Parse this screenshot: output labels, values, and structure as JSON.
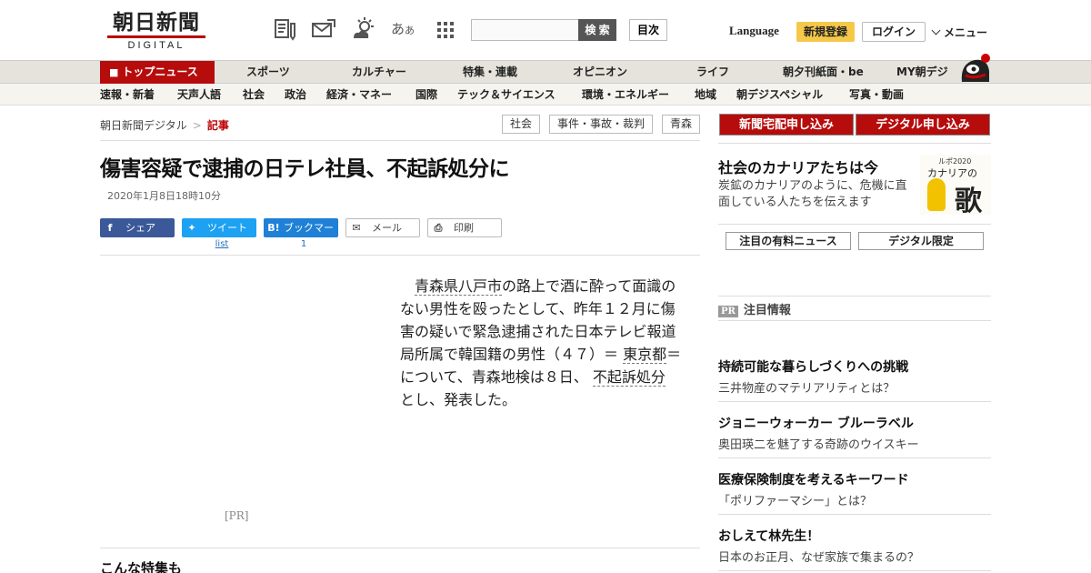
{
  "header": {
    "logo_kanji": "朝日新聞",
    "logo_sub": "DIGITAL",
    "search_button": "検 索",
    "search_placeholder": "",
    "toc_button": "目次",
    "language": "Language",
    "register": "新規登録",
    "login": "ログイン",
    "menu": "メニュー"
  },
  "nav": {
    "top": "トップニュース",
    "items": [
      "スポーツ",
      "カルチャー",
      "特集・連載",
      "オピニオン",
      "ライフ",
      "朝夕刊紙面・be",
      "MY朝デジ"
    ]
  },
  "subnav": {
    "items": [
      "速報・新着",
      "天声人語",
      "社会",
      "政治",
      "経済・マネー",
      "国際",
      "テック＆サイエンス",
      "環境・エネルギー",
      "地域",
      "朝デジスペシャル",
      "写真・動画"
    ]
  },
  "breadcrumb": {
    "home": "朝日新聞デジタル",
    "separator": ">",
    "current": "記事"
  },
  "tags": [
    "社会",
    "事件・事故・裁判",
    "青森"
  ],
  "article": {
    "title": "傷害容疑で逮捕の日テレ社員、不起訴処分に",
    "date": "2020年1月8日18時10分",
    "body": {
      "k1": "青森県八戸市",
      "t1": "の路上で酒に酔って面識のない男性を殴ったとして、昨年１２月に傷害の疑いで緊急逮捕された日本テレビ報道局所属で韓国籍の男性（４７）＝",
      "k2": "東京都",
      "t2": "＝について、青森地検は８日、",
      "k3": "不起訴処分",
      "t3": "とし、発表した。"
    },
    "pr": "[PR]",
    "special_heading": "こんな特集も"
  },
  "share": {
    "facebook": "シェア",
    "twitter": "ツイート",
    "hatena": "ブックマーク",
    "mail": "メール",
    "print": "印刷",
    "twitter_count": "list",
    "hatena_count": "1"
  },
  "sidebar": {
    "subscribe_paper": "新聞宅配申し込み",
    "subscribe_digital": "デジタル申し込み",
    "canary_title": "社会のカナリアたちは今",
    "canary_desc": "炭鉱のカナリアのように、危機に直面している人たちを伝えます",
    "canary_img_top": "ルポ2020",
    "canary_img_mid": "カナリアの",
    "canary_img_big": "歌",
    "tab_paid": "注目の有料ニュース",
    "tab_digital": "デジタル限定",
    "pr_badge": "PR",
    "pr_heading": "注目情報",
    "ads": [
      {
        "title": "持続可能な暮らしづくりへの挑戦",
        "sub": "三井物産のマテリアリティとは？"
      },
      {
        "title": "ジョニーウォーカー ブルーラベル",
        "sub": "奥田瑛二を魅了する奇跡のウイスキー"
      },
      {
        "title": "医療保険制度を考えるキーワード",
        "sub": "「ポリファーマシー」とは？"
      },
      {
        "title": "おしえて林先生！",
        "sub": "日本のお正月、なぜ家族で集まるの？"
      }
    ]
  },
  "colors": {
    "brand_red": "#b70c0c",
    "register_yellow": "#f5c84a",
    "facebook": "#3b5998",
    "twitter": "#1da1f2",
    "hatena": "#1e80d6"
  },
  "icons": [
    "newspaper-pen-icon",
    "mail-icon",
    "weather-icon",
    "font-size-icon",
    "grid-menu-icon",
    "home-icon",
    "chevron-down-icon",
    "mascot-icon"
  ]
}
